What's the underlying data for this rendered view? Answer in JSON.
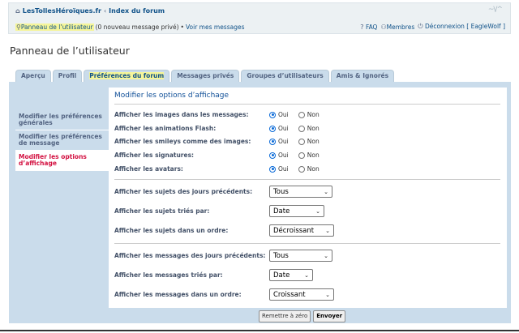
{
  "header": {
    "site_name": "LesTollesHéroïques.fr",
    "crumb_sep": "‹",
    "forum_index": "Index du forum",
    "logo_mark": "~\\/^",
    "user_panel_link": "Panneau de l’utilisateur",
    "new_messages": "(0 nouveau message privé)",
    "bullet": "•",
    "view_messages": "Voir mes messages",
    "faq": "FAQ",
    "members": "Membres",
    "logout": "Déconnexion [ EagleWolf ]"
  },
  "page_title": "Panneau de l’utilisateur",
  "tabs": [
    {
      "label": "Aperçu"
    },
    {
      "label": "Profil"
    },
    {
      "label": "Préférences du forum"
    },
    {
      "label": "Messages privés"
    },
    {
      "label": "Groupes d’utilisateurs"
    },
    {
      "label": "Amis & Ignorés"
    }
  ],
  "sidenav": [
    {
      "label": "Modifier les préférences générales"
    },
    {
      "label": "Modifier les préférences de message"
    },
    {
      "label": "Modifier les options d’affichage"
    }
  ],
  "section_title": "Modifier les options d’affichage",
  "yes": "Oui",
  "no": "Non",
  "radio_rows": [
    {
      "label": "Afficher les images dans les messages:",
      "value": "Oui"
    },
    {
      "label": "Afficher les animations Flash:",
      "value": "Oui"
    },
    {
      "label": "Afficher les smileys comme des images:",
      "value": "Oui"
    },
    {
      "label": "Afficher les signatures:",
      "value": "Oui"
    },
    {
      "label": "Afficher les avatars:",
      "value": "Oui"
    }
  ],
  "topic_rows": [
    {
      "label": "Afficher les sujets des jours précédents:",
      "selected": "Tous"
    },
    {
      "label": "Afficher les sujets triés par:",
      "selected": "Date"
    },
    {
      "label": "Afficher les sujets dans un ordre:",
      "selected": "Décroissant"
    }
  ],
  "post_rows": [
    {
      "label": "Afficher les messages des jours précédents:",
      "selected": "Tous"
    },
    {
      "label": "Afficher les messages triés par:",
      "selected": "Date"
    },
    {
      "label": "Afficher les messages dans un ordre:",
      "selected": "Croissant"
    }
  ],
  "buttons": {
    "reset": "Remettre à zéro",
    "submit": "Envoyer"
  },
  "colors": {
    "link": "#105289",
    "panel": "#cadceb",
    "highlight": "#f5f59a",
    "active_nav": "#d31141"
  }
}
